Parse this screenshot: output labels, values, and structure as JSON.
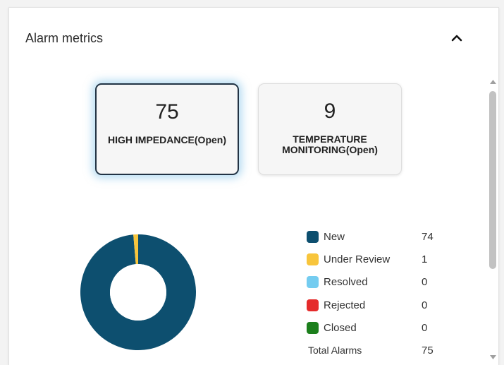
{
  "panel": {
    "title": "Alarm metrics"
  },
  "kpis": [
    {
      "value": "75",
      "label": "HIGH IMPEDANCE(Open)"
    },
    {
      "value": "9",
      "label": "TEMPERATURE MONITORING(Open)"
    }
  ],
  "legend": {
    "items": [
      {
        "label": "New",
        "count": "74",
        "color": "#0d4f6f"
      },
      {
        "label": "Under Review",
        "count": "1",
        "color": "#f8c53c"
      },
      {
        "label": "Resolved",
        "count": "0",
        "color": "#74ccf0"
      },
      {
        "label": "Rejected",
        "count": "0",
        "color": "#e52b2b"
      },
      {
        "label": "Closed",
        "count": "0",
        "color": "#1c7f1c"
      }
    ],
    "total_label": "Total Alarms",
    "total_count": "75"
  },
  "chart_data": {
    "type": "pie",
    "categories": [
      "New",
      "Under Review",
      "Resolved",
      "Rejected",
      "Closed"
    ],
    "values": [
      74,
      1,
      0,
      0,
      0
    ],
    "colors": [
      "#0d4f6f",
      "#f8c53c",
      "#74ccf0",
      "#e52b2b",
      "#1c7f1c"
    ],
    "donut": true,
    "legend": "right"
  },
  "icons": {
    "collapse": "chevron-up-icon",
    "scroll_up": "triangle-up-icon",
    "scroll_down": "triangle-down-icon"
  }
}
